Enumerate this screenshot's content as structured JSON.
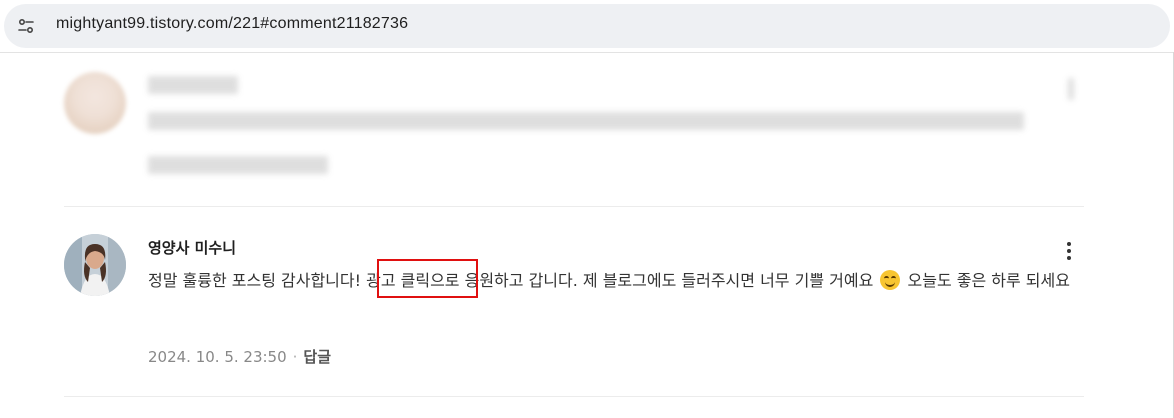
{
  "browser": {
    "url": "mightyant99.tistory.com/221#comment21182736",
    "site_info_icon": "tune-icon"
  },
  "comments": [
    {
      "author": "",
      "text": "",
      "date": "",
      "blurred": true
    },
    {
      "author": "영양사 미수니",
      "text_before_emoji": "정말 훌륭한 포스팅 감사합니다! 광고 클릭으로 응원하고 갑니다. 제 블로그에도 들러주시면 너무 기쁠 거예요",
      "emoji": "smiling-face-icon",
      "text_after_emoji": " 오늘도 좋은 하루 되세요",
      "date": "2024. 10. 5. 23:50",
      "separator": "·",
      "reply_label": "답글",
      "more_icon": "more-vertical-icon"
    }
  ],
  "annotation": {
    "color": "#e01010",
    "highlighted_text": "광고 클릭으"
  }
}
